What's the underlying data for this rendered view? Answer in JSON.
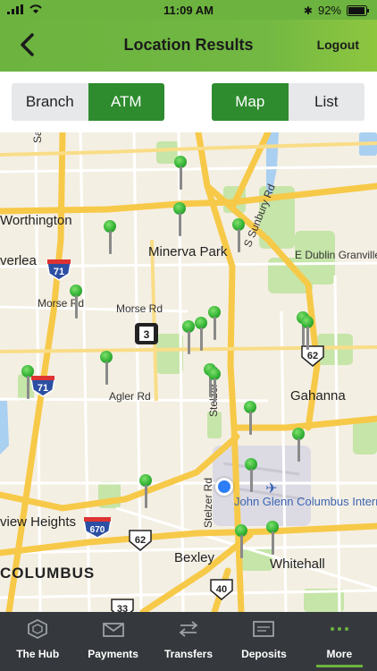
{
  "status": {
    "time": "11:09 AM",
    "battery": "92%"
  },
  "header": {
    "title": "Location Results",
    "logout_label": "Logout",
    "back_icon": "chevron-left-icon"
  },
  "type_toggle": {
    "options": [
      "Branch",
      "ATM"
    ],
    "selected": "ATM"
  },
  "view_toggle": {
    "options": [
      "Map",
      "List"
    ],
    "selected": "Map"
  },
  "map": {
    "labels": {
      "worthington": "Worthington",
      "minerva_park": "Minerva Park",
      "morse_rd": "Morse Rd",
      "morse_rd_west": "Morse Rd",
      "agler_rd": "Agler Rd",
      "gahanna": "Gahanna",
      "sunbury_rd": "S Sunbury Rd",
      "e_dublin_granville": "E Dublin Granville",
      "stelzer_rd": "Stelzer Rd",
      "stelzer_rd_south": "Stelzer Rd",
      "airport": "John Glenn Columbus International Airport (CMH)",
      "view_heights": "view Heights",
      "bexley": "Bexley",
      "whitehall": "Whitehall",
      "columbus": "COLUMBUS",
      "overlea": "verlea",
      "sanc": "Sanc"
    },
    "shields": {
      "i71_north": "71",
      "i71_south": "71",
      "i670": "670",
      "us62_east": "62",
      "us62_south": "62",
      "us40": "40",
      "us33": "33",
      "oh3": "3"
    },
    "atm_pin_count": 20
  },
  "tabs": [
    {
      "label": "The Hub",
      "icon": "hexagon-icon"
    },
    {
      "label": "Payments",
      "icon": "envelope-icon"
    },
    {
      "label": "Transfers",
      "icon": "transfer-arrows-icon"
    },
    {
      "label": "Deposits",
      "icon": "check-deposit-icon"
    },
    {
      "label": "More",
      "icon": "more-dots-icon"
    }
  ],
  "active_tab": "More",
  "colors": {
    "brand_green": "#6db33f",
    "toggle_active": "#2e8b2e",
    "tabbar_bg": "#35393d",
    "location_blue": "#2d7df6"
  }
}
